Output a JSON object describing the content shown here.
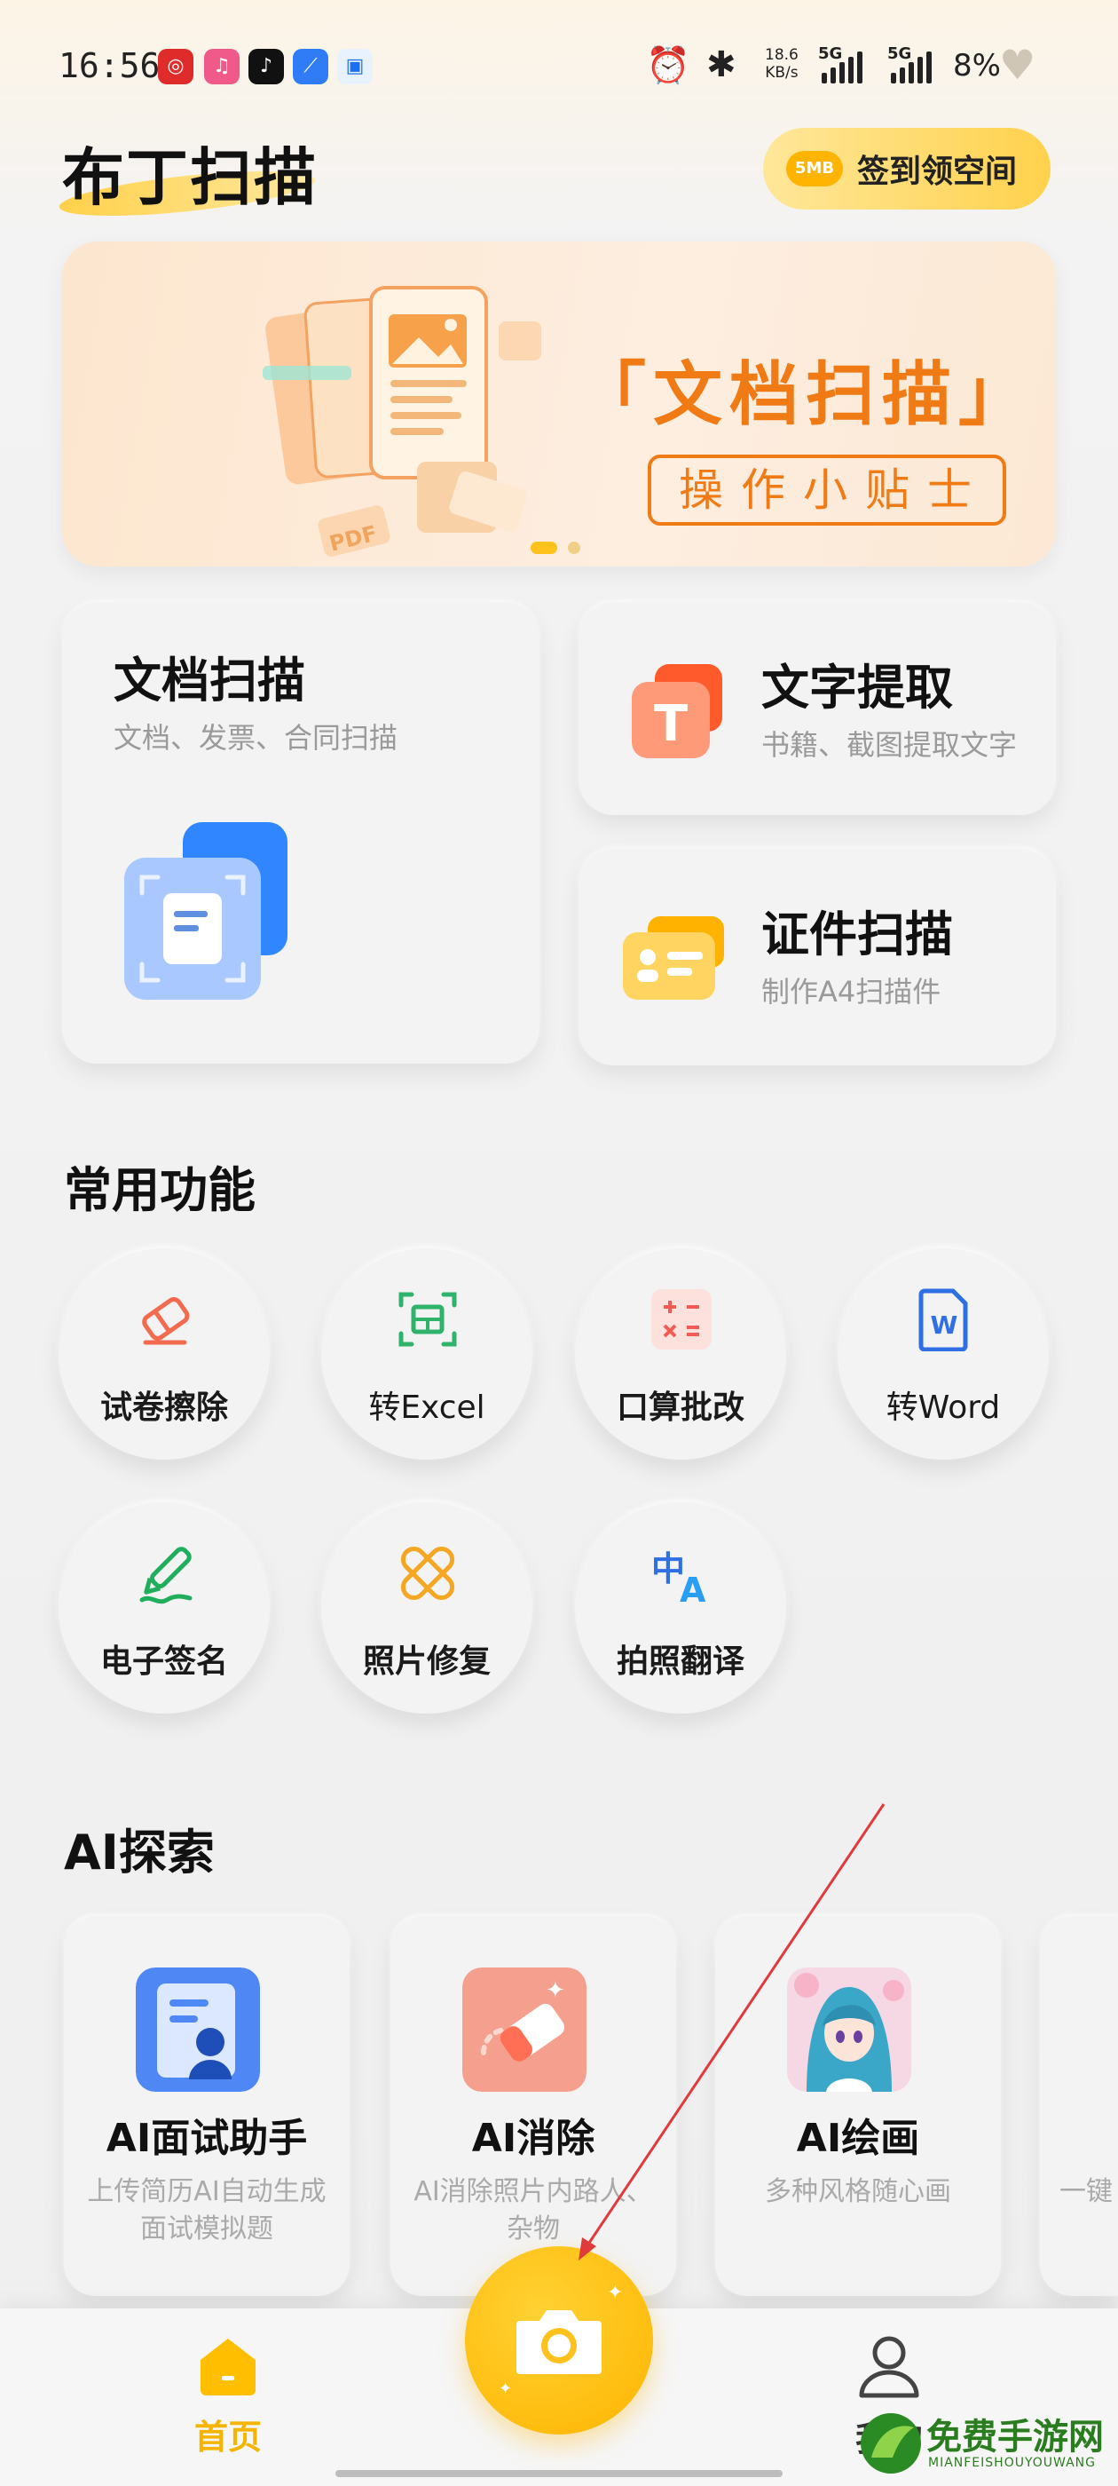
{
  "status_bar": {
    "time": "16:56",
    "speed_value": "18.6",
    "speed_unit": "KB/s",
    "network_1": "5G",
    "network_2": "5G",
    "battery": "8%"
  },
  "header": {
    "app_name": "布丁扫描",
    "checkin_badge": "5MB",
    "checkin_label": "签到领空间"
  },
  "banner": {
    "title": "「文档扫描」",
    "subtitle": "操作小贴士",
    "pdf_tag": "PDF",
    "active_index": 0,
    "count": 2
  },
  "main_cards": {
    "doc_scan": {
      "title": "文档扫描",
      "subtitle": "文档、发票、合同扫描"
    },
    "text_extract": {
      "title": "文字提取",
      "subtitle": "书籍、截图提取文字",
      "icon_letter": "T"
    },
    "id_scan": {
      "title": "证件扫描",
      "subtitle": "制作A4扫描件"
    }
  },
  "common_tools": {
    "title": "常用功能",
    "items": [
      {
        "label": "试卷擦除",
        "icon": "eraser-icon"
      },
      {
        "label": "转Excel",
        "icon": "excel-icon"
      },
      {
        "label": "口算批改",
        "icon": "calculator-icon"
      },
      {
        "label": "转Word",
        "icon": "word-icon"
      },
      {
        "label": "电子签名",
        "icon": "pen-icon"
      },
      {
        "label": "照片修复",
        "icon": "bandage-icon"
      },
      {
        "label": "拍照翻译",
        "icon": "translate-icon"
      }
    ],
    "word_letter": "W",
    "translate_glyph": "中",
    "translate_glyph_2": "A"
  },
  "ai_explore": {
    "title": "AI探索",
    "items": [
      {
        "title": "AI面试助手",
        "subtitle": "上传简历AI自动生成面试模拟题"
      },
      {
        "title": "AI消除",
        "subtitle": "AI消除照片内路人、杂物"
      },
      {
        "title": "AI绘画",
        "subtitle": "多种风格随心画"
      },
      {
        "title": "",
        "subtitle": "一键"
      }
    ]
  },
  "bottom_nav": {
    "home_label": "首页",
    "me_label": "我的"
  },
  "watermark": {
    "text": "免费手游网",
    "sub": "MIANFEISHOUYOUWANG"
  },
  "colors": {
    "accent_yellow": "#ffc21c",
    "banner_orange": "#f07a14",
    "doc_blue": "#4d8dff",
    "text_extract_orange": "#ff7a45",
    "id_yellow": "#f7b500",
    "excel_green": "#2fb36b",
    "calc_red": "#f25c54",
    "word_blue": "#2f6fe4",
    "annotation_red": "#e03a3a"
  }
}
